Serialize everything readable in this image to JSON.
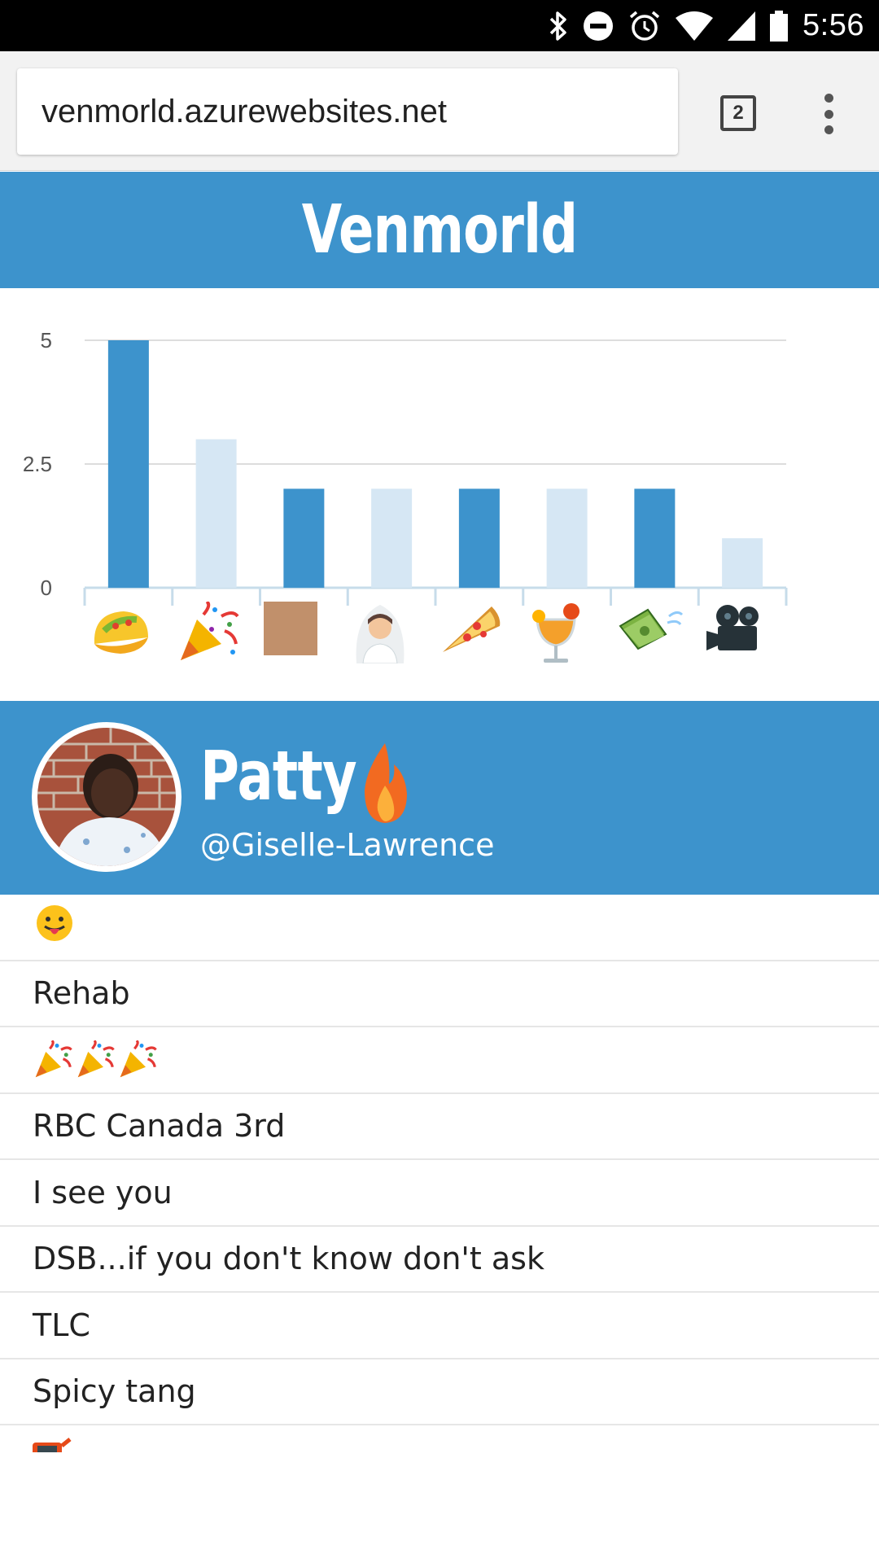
{
  "status_bar": {
    "time": "5:56",
    "icons": [
      "bluetooth-icon",
      "do-not-disturb-icon",
      "alarm-icon",
      "wifi-icon",
      "signal-icon",
      "battery-icon"
    ]
  },
  "browser": {
    "url": "venmorld.azurewebsites.net",
    "tab_count": "2",
    "menu_icon": "more-vert-icon"
  },
  "header": {
    "title": "Venmorld"
  },
  "chart_data": {
    "type": "bar",
    "categories": [
      "taco",
      "party-popper",
      "brown-square",
      "bride",
      "pizza",
      "tropical-drink",
      "money-with-wings",
      "movie-camera"
    ],
    "values": [
      5,
      3,
      2,
      2,
      2,
      2,
      2,
      1
    ],
    "yticks": [
      "0",
      "2.5",
      "5"
    ],
    "ylim": [
      0,
      5
    ],
    "grid": true,
    "colors": [
      "#3d93cc",
      "#d6e7f4",
      "#3d93cc",
      "#d6e7f4",
      "#3d93cc",
      "#d6e7f4",
      "#3d93cc",
      "#d6e7f4"
    ]
  },
  "profile": {
    "name": "Patty",
    "handle": "@Giselle-Lawrence",
    "badge_icon": "fire-icon"
  },
  "messages": [
    {
      "text": "",
      "icon": "tongue-face-icon"
    },
    {
      "text": "Rehab"
    },
    {
      "text": "",
      "icon": "party-popper-icon",
      "count": 3
    },
    {
      "text": "RBC Canada 3rd"
    },
    {
      "text": "I see you"
    },
    {
      "text": "DSB...if you don't know don't ask"
    },
    {
      "text": "TLC"
    },
    {
      "text": "Spicy tang"
    }
  ],
  "colors": {
    "accent": "#3d93cc",
    "bar_light": "#d6e7f4",
    "status_bar": "#000000"
  }
}
